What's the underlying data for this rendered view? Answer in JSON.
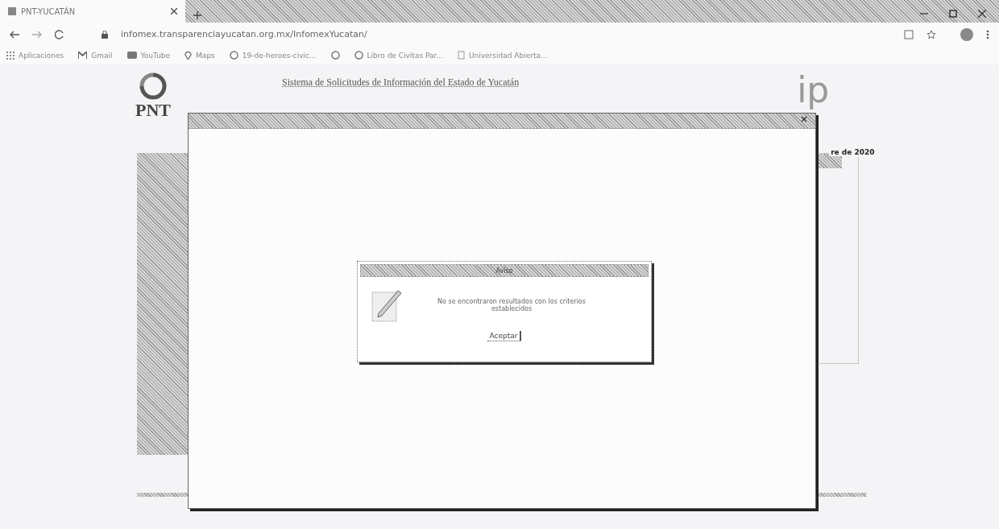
{
  "browser": {
    "tabs": [
      {
        "title": "PNT-YUCATÁN",
        "selected": true
      }
    ],
    "address": "infomex.transparenciayucatan.org.mx/InfomexYucatan/",
    "bookmarks": [
      {
        "label": "Aplicaciones",
        "kind": "grid"
      },
      {
        "label": "Gmail",
        "kind": "mail"
      },
      {
        "label": "YouTube",
        "kind": "video"
      },
      {
        "label": "Maps",
        "kind": "pin"
      },
      {
        "label": "19-de-heroes-civic...",
        "kind": "globe"
      },
      {
        "kind": "globe"
      },
      {
        "label": "Libro de Civitas Par...",
        "kind": "globe"
      },
      {
        "label": "Universidad Abierta...",
        "kind": "page"
      }
    ]
  },
  "page": {
    "logo_text": "PNT",
    "title": "Sistema de Solicitudes de Información del Estado de Yucatán",
    "right_logo_text": "ip",
    "date": "re de 2020"
  },
  "modal": {
    "dialog": {
      "title": "Aviso",
      "message": "No se encontraron resultados con los criterios establecidos",
      "button": "Aceptar"
    }
  }
}
